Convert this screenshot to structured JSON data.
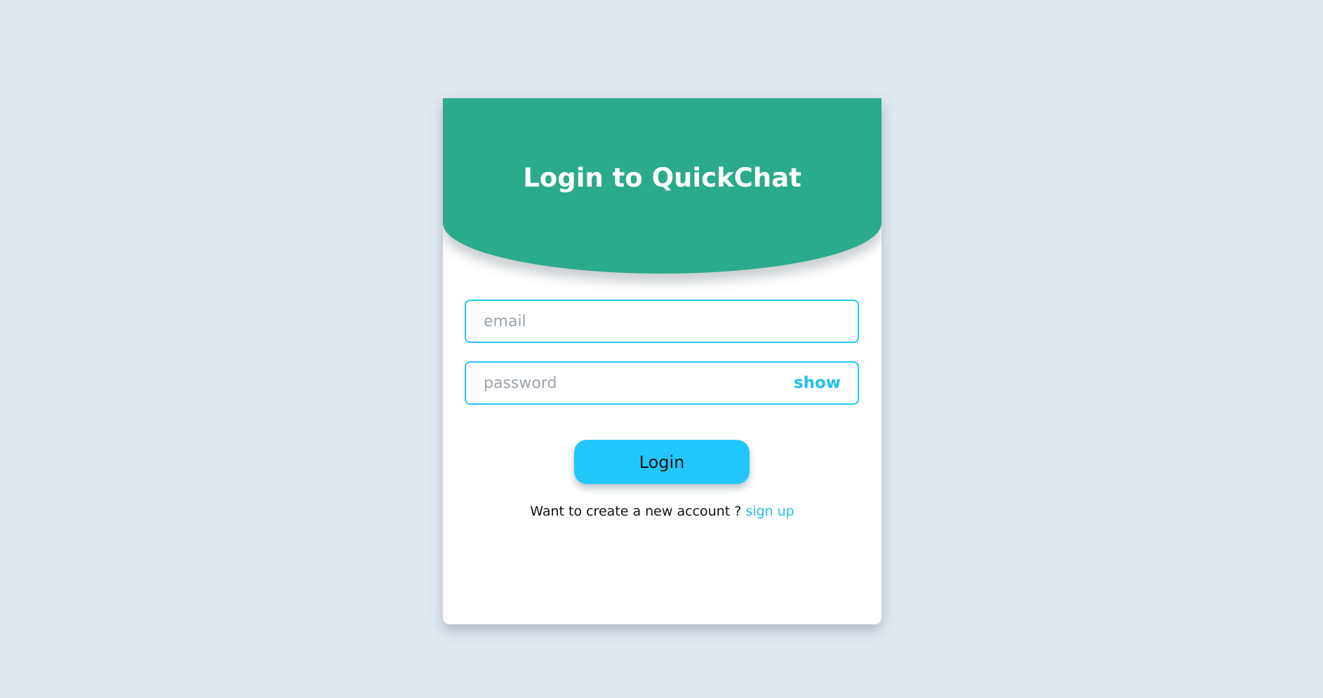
{
  "header": {
    "title": "Login to QuickChat"
  },
  "form": {
    "email_placeholder": "email",
    "password_placeholder": "password",
    "show_label": "show",
    "login_label": "Login"
  },
  "footer": {
    "prompt": "Want to create a new account ? ",
    "signup_label": "sign up"
  },
  "colors": {
    "page_background": "#e0e8f0",
    "header_background": "#2baa8c",
    "accent": "#22c8fd",
    "field_border": "#20c8f6"
  }
}
